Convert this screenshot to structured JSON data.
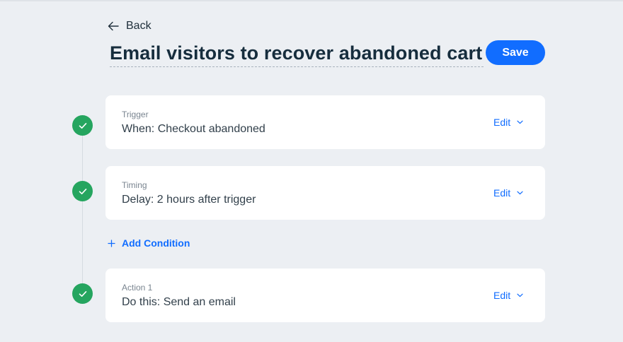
{
  "header": {
    "back_label": "Back",
    "title": "Email visitors to recover abandoned cart",
    "save_label": "Save"
  },
  "steps": [
    {
      "label": "Trigger",
      "value": "When: Checkout abandoned",
      "edit_label": "Edit",
      "status": "complete"
    },
    {
      "label": "Timing",
      "value": "Delay: 2 hours after trigger",
      "edit_label": "Edit",
      "status": "complete"
    },
    {
      "label": "Action 1",
      "value": "Do this: Send an email",
      "edit_label": "Edit",
      "status": "complete"
    }
  ],
  "add_condition": {
    "label": "Add Condition"
  },
  "colors": {
    "accent": "#116dff",
    "success": "#25a55f",
    "background": "#eceff3",
    "card": "#ffffff",
    "title_text": "#162d3d"
  },
  "icons": {
    "back": "arrow-left-icon",
    "step_status": "check-icon",
    "edit_menu": "chevron-down-icon",
    "add": "plus-icon"
  }
}
